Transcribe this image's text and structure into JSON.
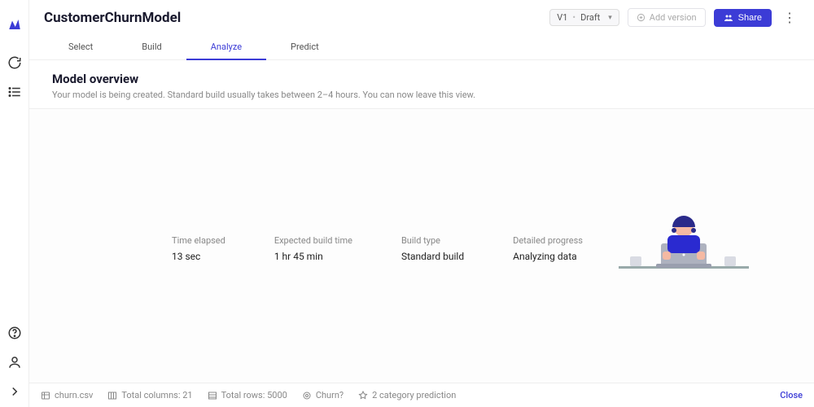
{
  "header": {
    "title": "CustomerChurnModel",
    "version": "V1",
    "status": "Draft",
    "add_version": "Add version",
    "share": "Share"
  },
  "tabs": {
    "select": "Select",
    "build": "Build",
    "analyze": "Analyze",
    "predict": "Predict",
    "active": "analyze"
  },
  "overview": {
    "title": "Model overview",
    "subtitle": "Your model is being created. Standard build usually takes between 2–4 hours. You can now leave this view."
  },
  "stats": {
    "elapsed_label": "Time elapsed",
    "elapsed_value": "13 sec",
    "expected_label": "Expected build time",
    "expected_value": "1 hr 45 min",
    "buildtype_label": "Build type",
    "buildtype_value": "Standard build",
    "progress_label": "Detailed progress",
    "progress_value": "Analyzing data"
  },
  "footer": {
    "file": "churn.csv",
    "cols": "Total columns: 21",
    "rows": "Total rows: 5000",
    "target": "Churn?",
    "predtype": "2 category prediction",
    "close": "Close"
  }
}
